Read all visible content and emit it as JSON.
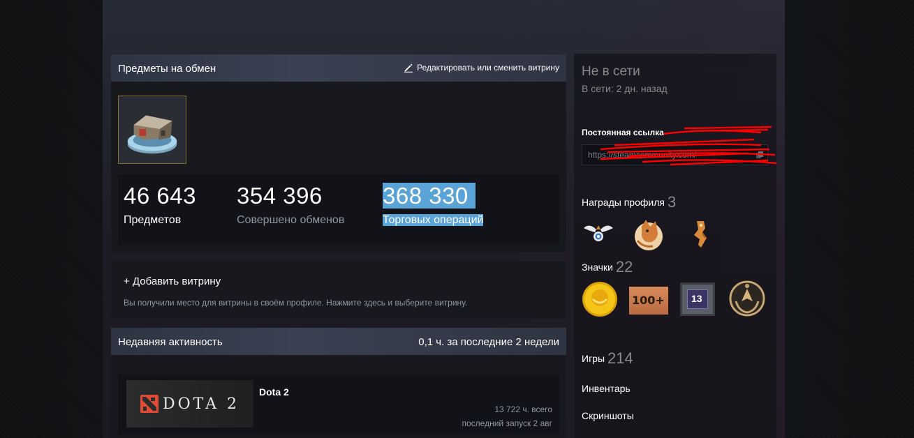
{
  "showcase": {
    "title": "Предметы на обмен",
    "edit_label": "Редактировать или сменить витрину",
    "stats": [
      {
        "value": "46 643",
        "label": "Предметов"
      },
      {
        "value": "354 396",
        "label": "Совершено обменов"
      },
      {
        "value": "368 330",
        "label": "Торговых операций"
      }
    ]
  },
  "add_showcase": {
    "title": "+ Добавить витрину",
    "description": "Вы получили место для витрины в своём профиле. Нажмите здесь и выберите витрину."
  },
  "activity": {
    "title": "Недавняя активность",
    "hours_summary": "0,1 ч. за последние 2 недели",
    "games": [
      {
        "name": "Dota 2",
        "logo_text": "DOTA 2",
        "total": "13 722 ч. всего",
        "last_played": "последний запуск 2 авг"
      }
    ]
  },
  "sidebar": {
    "status": "Не в сети",
    "last_online": "В сети: 2 дн. назад",
    "permalink_label": "Постоянная ссылка",
    "permalink_value": "https://steamcommunity.com/",
    "awards_label": "Награды профиля",
    "awards_count": "3",
    "badges_label": "Значки",
    "badges_count": "22",
    "badge_level_label": "13",
    "badge_100_label": "100+",
    "games_label": "Игры",
    "games_count": "214",
    "inventory_label": "Инвентарь",
    "screenshots_label": "Скриншоты"
  },
  "colors": {
    "highlight": "#5aa3d6",
    "dim_text": "#8f98a0",
    "status_gray": "#898989",
    "dota_red": "#e14b33",
    "redaction": "#ff0000"
  }
}
